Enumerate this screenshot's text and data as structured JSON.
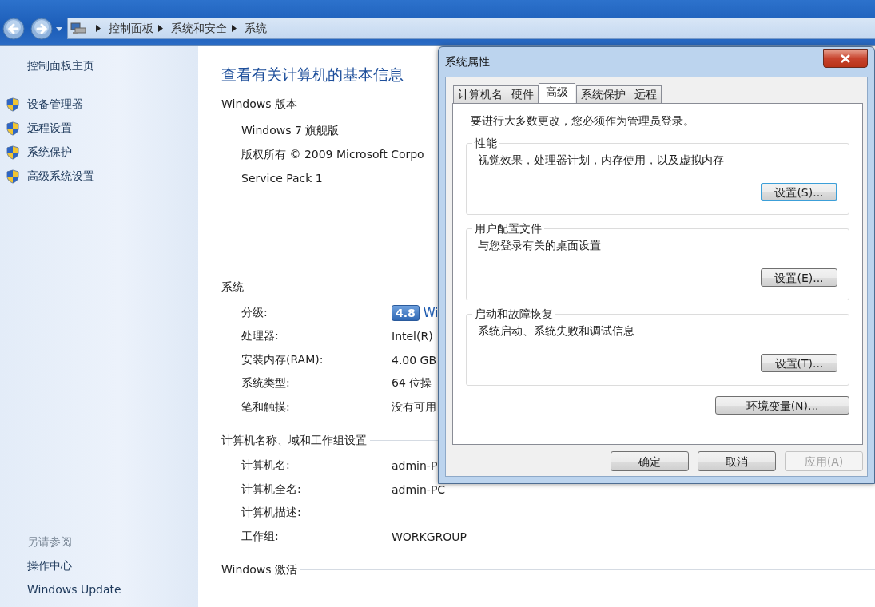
{
  "nav": {
    "breadcrumb": [
      "控制面板",
      "系统和安全",
      "系统"
    ]
  },
  "sidebar": {
    "home": "控制面板主页",
    "tasks": [
      "设备管理器",
      "远程设置",
      "系统保护",
      "高级系统设置"
    ],
    "see_also_title": "另请参阅",
    "see_also": [
      "操作中心",
      "Windows Update"
    ]
  },
  "main": {
    "title": "查看有关计算机的基本信息",
    "sections": [
      {
        "heading": "Windows 版本",
        "lines": [
          "Windows 7 旗舰版",
          "版权所有 © 2009 Microsoft Corpo",
          "Service Pack 1"
        ]
      },
      {
        "heading": "系统",
        "rows": [
          {
            "kind": "rating",
            "label": "分级:",
            "badge": "4.8",
            "value": "Wi"
          },
          {
            "kind": "text",
            "label": "处理器:",
            "value": "Intel(R)"
          },
          {
            "kind": "text",
            "label": "安装内存(RAM):",
            "value": "4.00 GB"
          },
          {
            "kind": "text",
            "label": "系统类型:",
            "value": "64 位操"
          },
          {
            "kind": "text",
            "label": "笔和触摸:",
            "value": "没有可用"
          }
        ]
      },
      {
        "heading": "计算机名称、域和工作组设置",
        "rows": [
          {
            "kind": "text",
            "label": "计算机名:",
            "value": "admin-P"
          },
          {
            "kind": "text",
            "label": "计算机全名:",
            "value": "admin-PC"
          },
          {
            "kind": "text",
            "label": "计算机描述:"
          },
          {
            "kind": "text",
            "label": "工作组:",
            "value": "WORKGROUP"
          }
        ]
      },
      {
        "heading": "Windows 激活"
      }
    ]
  },
  "dialog": {
    "title": "系统属性",
    "tabs": [
      {
        "label": "计算机名",
        "selected": false
      },
      {
        "label": "硬件",
        "selected": false
      },
      {
        "label": "高级",
        "selected": true
      },
      {
        "label": "系统保护",
        "selected": false
      },
      {
        "label": "远程",
        "selected": false
      }
    ],
    "notice": "要进行大多数更改，您必须作为管理员登录。",
    "groups": [
      {
        "title": "性能",
        "description": "视觉效果，处理器计划，内存使用，以及虚拟内存",
        "button": {
          "label": "设置(S)...",
          "focused": true
        }
      },
      {
        "title": "用户配置文件",
        "description": "与您登录有关的桌面设置",
        "button": {
          "label": "设置(E)...",
          "focused": false
        }
      },
      {
        "title": "启动和故障恢复",
        "description": "系统启动、系统失败和调试信息",
        "button": {
          "label": "设置(T)...",
          "focused": false
        }
      }
    ],
    "env_button": {
      "label": "环境变量(N)...",
      "focused": false
    },
    "buttons": [
      {
        "label": "确定",
        "disabled": false
      },
      {
        "label": "取消",
        "disabled": false
      },
      {
        "label": "应用(A)",
        "disabled": true
      }
    ]
  }
}
